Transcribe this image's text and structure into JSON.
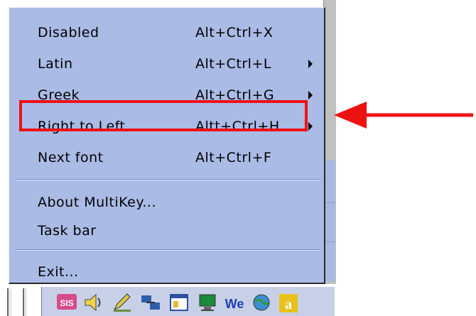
{
  "menu": {
    "items": [
      {
        "label": "Disabled",
        "shortcut": "Alt+Ctrl+X",
        "has_submenu": false
      },
      {
        "label": "Latin",
        "shortcut": "Alt+Ctrl+L",
        "has_submenu": true
      },
      {
        "label": "Greek",
        "shortcut": "Alt+Ctrl+G",
        "has_submenu": true
      },
      {
        "label": "Right to Left",
        "shortcut": "Altt+Ctrl+H",
        "has_submenu": true
      },
      {
        "label": "Next font",
        "shortcut": "Alt+Ctrl+F",
        "has_submenu": false
      },
      {
        "label": "About MultiKey...",
        "shortcut": "",
        "has_submenu": false
      },
      {
        "label": "Task bar",
        "shortcut": "",
        "has_submenu": false
      },
      {
        "label": "Exit...",
        "shortcut": "",
        "has_submenu": false
      }
    ]
  },
  "annotation": {
    "highlighted_item": "Right to Left",
    "color": "#ee1111"
  },
  "taskbar": {
    "tray_icons": [
      "sis-icon",
      "speaker-icon",
      "pencil-icon",
      "network-icon",
      "window-icon",
      "monitor-icon",
      "we-icon",
      "globe-icon",
      "letter-a-icon"
    ]
  },
  "colors": {
    "menu_bg": "#aabbe6",
    "accent": "#ee1111"
  }
}
